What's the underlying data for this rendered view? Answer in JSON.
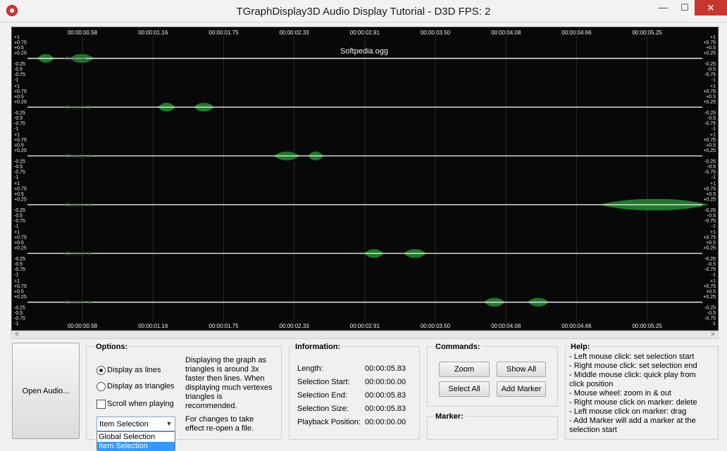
{
  "window": {
    "title": "TGraphDisplay3D Audio Display Tutorial - D3D FPS: 2",
    "min_glyph": "—",
    "max_glyph": "☐",
    "close_glyph": "✕"
  },
  "graph": {
    "file_label": "Softpedia.ogg",
    "time_labels": [
      "00:00:00.58",
      "00:00:01.16",
      "00:00:01.75",
      "00:00:02.33",
      "00:00:02.91",
      "00:00:03.50",
      "00:00:04.08",
      "00:00:04.66",
      "00:00:05.25"
    ],
    "amp_labels_top": [
      "+1",
      "+0.75",
      "+0.5",
      "+0.25"
    ],
    "amp_labels_bottom": [
      "-0.25",
      "-0.5",
      "-0.75",
      "-1"
    ],
    "channel_labels": [
      "Channel-1",
      "Channel-2",
      "Channel-3",
      "Channel-4",
      "Channel-5",
      "Channel-6"
    ],
    "colors": {
      "background": "#080808",
      "wave": "#1e7a28",
      "baseline": "#e8e8e8",
      "grid": "#2a2a2a",
      "text": "#f0f0f0"
    }
  },
  "scrollbar": {
    "left_arrow": "<",
    "right_arrow": ">"
  },
  "open_audio": {
    "label": "Open Audio..."
  },
  "options": {
    "title": "Options:",
    "display_lines": "Display as lines",
    "display_triangles": "Display as triangles",
    "scroll_when_playing": "Scroll when playing",
    "note1_lines": [
      "Displaying the graph as",
      "triangles is around 3x",
      "faster then lines. When",
      "displaying much vertexes",
      "triangles is",
      "recommended."
    ],
    "note2_lines": [
      "For changes to take",
      "effect re-open a file."
    ],
    "selection_combo": {
      "value": "Item Selection",
      "options": [
        "Global Selection",
        "Item Selection"
      ]
    }
  },
  "information": {
    "title": "Information:",
    "rows": [
      {
        "label": "Length:",
        "value": "00:00:05.83"
      },
      {
        "label": "Selection Start:",
        "value": "00:00:00.00"
      },
      {
        "label": "Selection End:",
        "value": "00:00:05.83"
      },
      {
        "label": "Selection Size:",
        "value": "00:00:05.83"
      },
      {
        "label": "Playback Position:",
        "value": "00:00:00.00"
      }
    ]
  },
  "commands": {
    "title": "Commands:",
    "zoom": "Zoom",
    "show_all": "Show All",
    "select_all": "Select All",
    "add_marker": "Add Marker",
    "marker_title": "Marker:"
  },
  "help": {
    "title": "Help:",
    "lines": [
      "- Left mouse click: set selection start",
      "- Right mouse click: set selection end",
      "- Middle mouse click: quick play from",
      "click position",
      "- Mouse wheel: zoom in & out",
      "- Right mouse click on marker: delete",
      "- Left mouse click on marker: drag",
      "- Add Marker will add a marker at the",
      "selection start"
    ]
  }
}
